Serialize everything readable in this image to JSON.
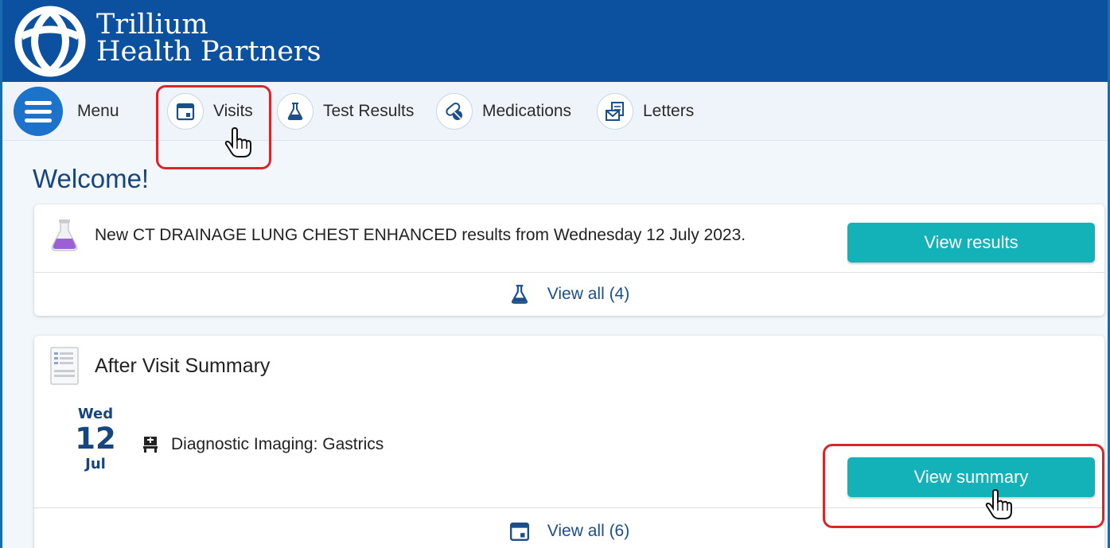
{
  "header": {
    "logo_line1": "Trillium",
    "logo_line2": "Health Partners"
  },
  "nav": {
    "items": [
      {
        "label": "Menu",
        "icon": "hamburger-icon"
      },
      {
        "label": "Visits",
        "icon": "calendar-icon"
      },
      {
        "label": "Test Results",
        "icon": "flask-icon"
      },
      {
        "label": "Medications",
        "icon": "pills-icon"
      },
      {
        "label": "Letters",
        "icon": "letter-icon"
      }
    ]
  },
  "main": {
    "welcome": "Welcome!",
    "results_card": {
      "message": "New CT DRAINAGE LUNG CHEST ENHANCED results from Wednesday 12 July 2023.",
      "button_label": "View results",
      "view_all_label": "View all (4)"
    },
    "visit_card": {
      "title": "After Visit Summary",
      "date_dow": "Wed",
      "date_day": "12",
      "date_mon": "Jul",
      "visit_name": "Diagnostic Imaging: Gastrics",
      "button_label": "View summary",
      "view_all_label": "View all (6)"
    }
  },
  "colors": {
    "header_bg": "#0b51a0",
    "accent_button": "#13b2b8",
    "highlight": "#d9262b",
    "heading_blue": "#17457d"
  }
}
